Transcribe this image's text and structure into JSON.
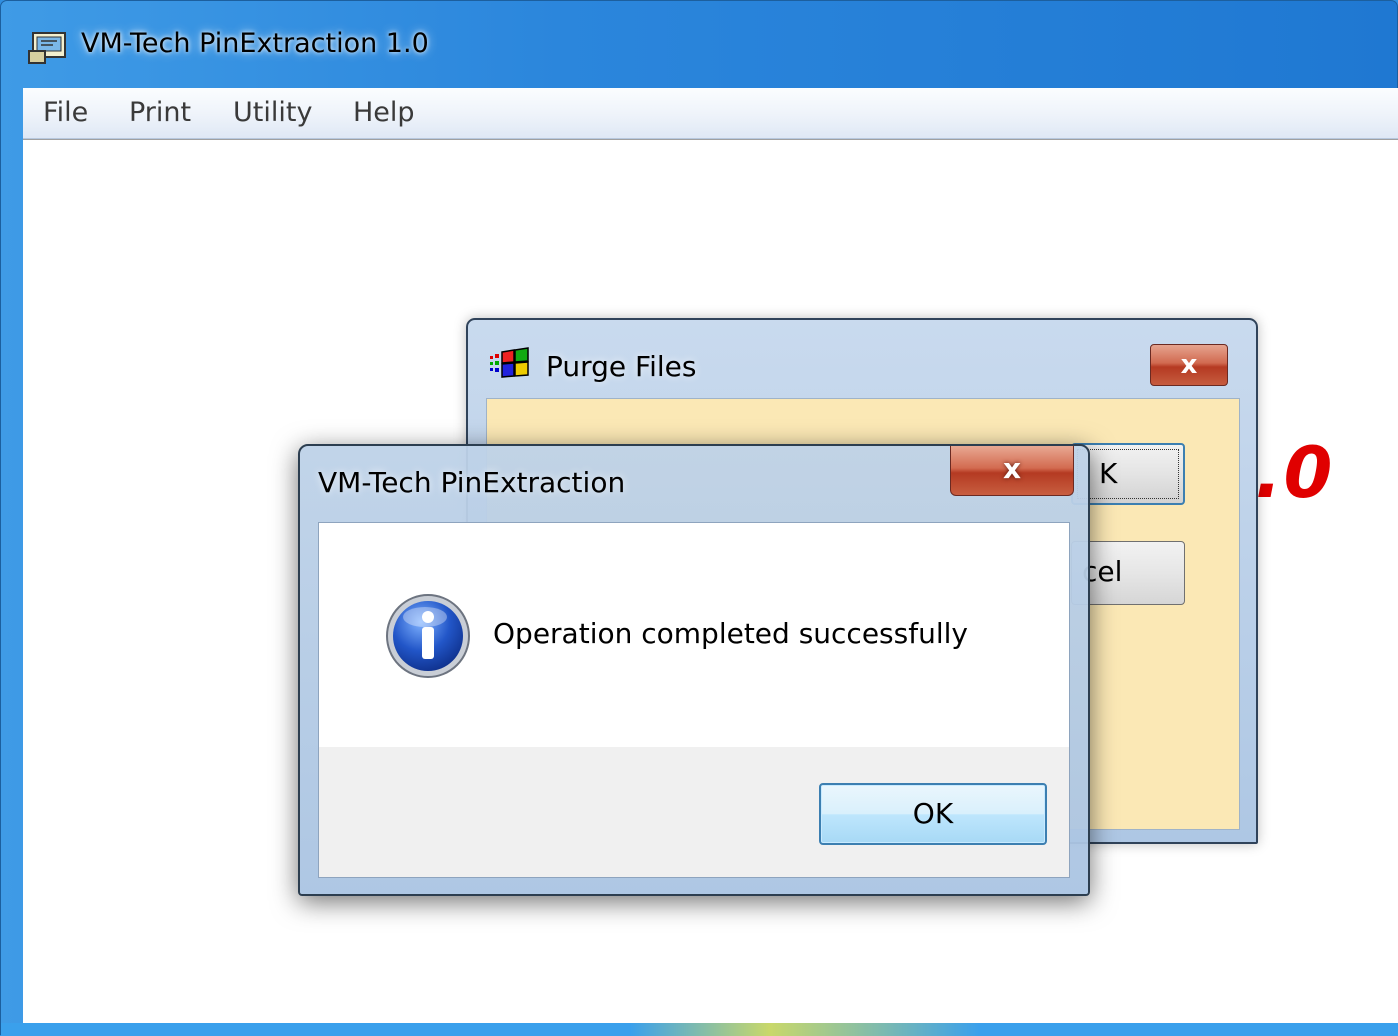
{
  "main_window": {
    "title": "VM-Tech PinExtraction 1.0",
    "icon": "app-window-icon"
  },
  "menu": {
    "items": [
      "File",
      "Print",
      "Utility",
      "Help"
    ]
  },
  "background": {
    "version_fragment": ".0"
  },
  "purge_dialog": {
    "title": "Purge Files",
    "icon": "windows-flag-icon",
    "close_label": "x",
    "ok_label": "K",
    "cancel_label": "cel"
  },
  "message_box": {
    "title": "VM-Tech PinExtraction",
    "close_label": "x",
    "icon": "info-icon",
    "message": "Operation completed successfully",
    "ok_label": "OK"
  },
  "colors": {
    "titlebar": "#2b86dc",
    "purge_body": "#fbe8b5",
    "version_red": "#e00000",
    "button_focus_border": "#3c7fb1"
  }
}
